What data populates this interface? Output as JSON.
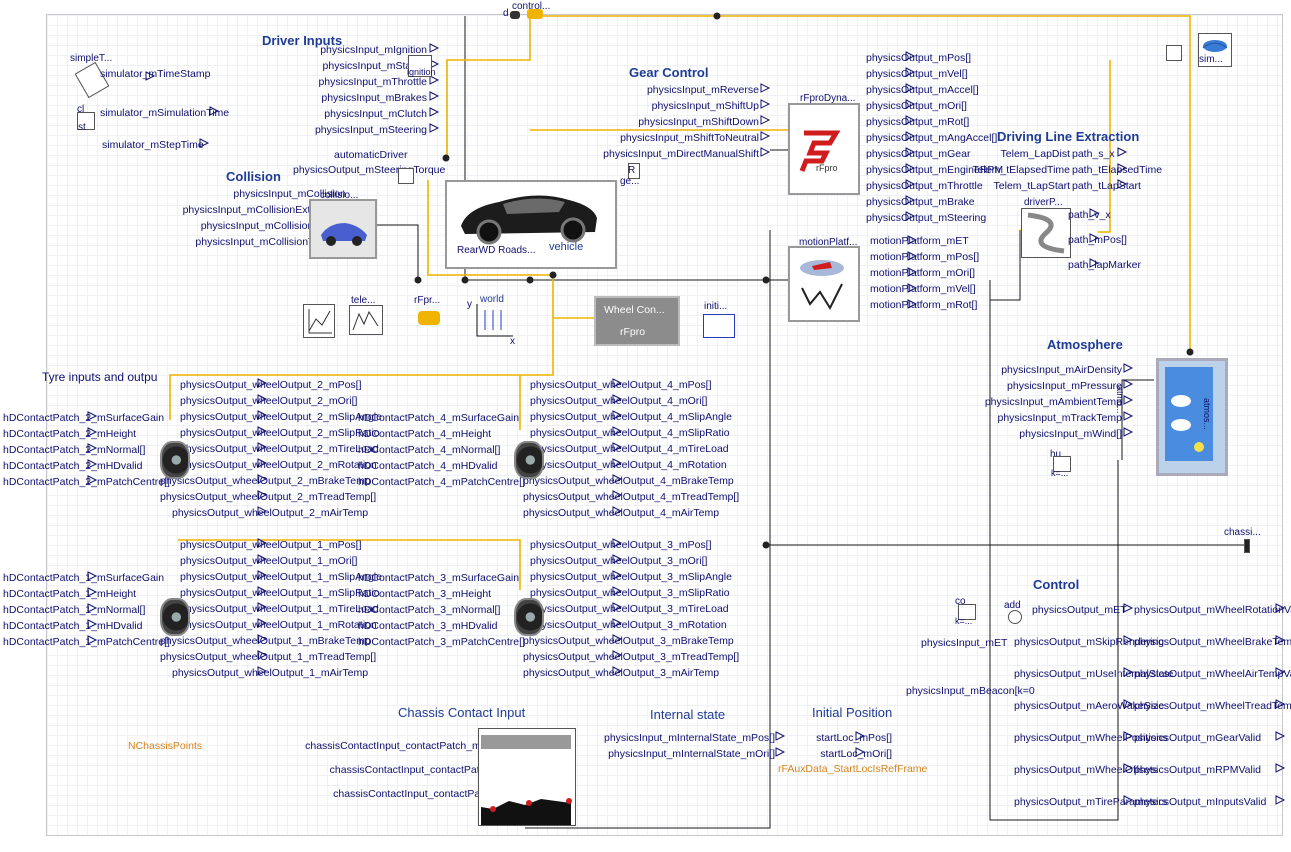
{
  "sections": {
    "driver_inputs": "Driver Inputs",
    "gear_control": "Gear Control",
    "collision": "Collision",
    "driving_line": "Driving Line Extraction",
    "atmosphere": "Atmosphere",
    "tyre_io": "Tyre inputs and outpu",
    "control": "Control",
    "chassis_contact": "Chassis Contact Input",
    "internal_state": "Internal state",
    "initial_position": "Initial Position"
  },
  "driver_inputs": [
    "physicsInput_mIgnition",
    "physicsInput_mStarter",
    "physicsInput_mThrottle",
    "physicsInput_mBrakes",
    "physicsInput_mClutch",
    "physicsInput_mSteering"
  ],
  "driver_extra": {
    "automatic": "automaticDriver",
    "steer_torque": "physicsOutput_mSteeringTorque",
    "ignition": "ignition"
  },
  "gear_inputs": [
    "physicsInput_mReverse",
    "physicsInput_mShiftUp",
    "physicsInput_mShiftDown",
    "physicsInput_mShiftToNeutral",
    "physicsInput_mDirectManualShift"
  ],
  "gear_extra": {
    "r": "R",
    "ge": "ge..."
  },
  "collision_inputs": [
    "physicsInput_mCollision",
    "physicsInput_mCollisionExtVector[]",
    "physicsInput_mCollisionForce[]",
    "physicsInput_mCollisionTorque[]"
  ],
  "collision_block": "collisio...",
  "top_left": {
    "simple": "simpleT...",
    "timestamp": "simulator_mTimeStamp",
    "cl": "cl",
    "simtime": "simulator_mSimulationTime",
    "st": "st",
    "steptime": "simulator_mStepTime"
  },
  "control_top": {
    "d": "d",
    "controller": "control..."
  },
  "sim_block": "sim...",
  "dyna": {
    "title": "rFproDyna...",
    "outputs": [
      "physicsOutput_mPos[]",
      "physicsOutput_mVel[]",
      "physicsOutput_mAccel[]",
      "physicsOutput_mOri[]",
      "physicsOutput_mRot[]",
      "physicsOutput_mAngAccel[]",
      "physicsOutput_mGear",
      "physicsOutput_mEngineRPM",
      "physicsOutput_mThrottle",
      "physicsOutput_mBrake",
      "physicsOutput_mSteering"
    ]
  },
  "logo_text": "rFpro",
  "motion": {
    "title": "motionPlatf...",
    "outputs": [
      "motionPlatform_mET",
      "motionPlatform_mPos[]",
      "motionPlatform_mOri[]",
      "motionPlatform_mVel[]",
      "motionPlatform_mRot[]"
    ]
  },
  "driving_line": {
    "telem": [
      "Telem_LapDist",
      "Telem_tElapsedTime",
      "Telem_tLapStart"
    ],
    "path_top": [
      "path_s_x",
      "path_tElapsedTime",
      "path_tLapStart"
    ],
    "driver_p": "driverP...",
    "path_bottom": [
      "path_v_x",
      "path_mPos[]",
      "path_lapMarker"
    ]
  },
  "vehicle": {
    "name": "RearWD Roads...",
    "label": "vehicle"
  },
  "small_blocks": {
    "tele": "tele...",
    "rfpr": "rFpr...",
    "world": "world",
    "y": "y",
    "x": "x",
    "wheel_con": "Wheel Con...",
    "wheel_con_sub": "rFpro",
    "initi": "initi..."
  },
  "atmosphere": {
    "inputs": [
      "physicsInput_mAirDensity",
      "physicsInput_mPressure",
      "physicsInput_mAmbientTemp",
      "physicsInput_mTrackTemp",
      "physicsInput_mWind[]"
    ],
    "atmo": "atmo...",
    "atmos": "atmos...",
    "hu": "hu",
    "k": "k=..."
  },
  "chassis_out": "chassi...",
  "wheels": {
    "w2_in": [
      "hDContactPatch_2_mSurfaceGain",
      "hDContactPatch_2_mHeight",
      "hDContactPatch_2_mNormal[]",
      "hDContactPatch_2_mHDvalid",
      "hDContactPatch_2_mPatchCentre[]"
    ],
    "w2_out": [
      "physicsOutput_wheelOutput_2_mPos[]",
      "physicsOutput_wheelOutput_2_mOri[]",
      "physicsOutput_wheelOutput_2_mSlipAngle",
      "physicsOutput_wheelOutput_2_mSlipRatio",
      "physicsOutput_wheelOutput_2_mTireLoad",
      "physicsOutput_wheelOutput_2_mRotation",
      "physicsOutput_wheelOutput_2_mBrakeTemp",
      "physicsOutput_wheelOutput_2_mTreadTemp[]",
      "physicsOutput_wheelOutput_2_mAirTemp"
    ],
    "w4_in": [
      "hDContactPatch_4_mSurfaceGain",
      "hDContactPatch_4_mHeight",
      "hDContactPatch_4_mNormal[]",
      "hDContactPatch_4_mHDvalid",
      "hDContactPatch_4_mPatchCentre[]"
    ],
    "w4_out": [
      "physicsOutput_wheelOutput_4_mPos[]",
      "physicsOutput_wheelOutput_4_mOri[]",
      "physicsOutput_wheelOutput_4_mSlipAngle",
      "physicsOutput_wheelOutput_4_mSlipRatio",
      "physicsOutput_wheelOutput_4_mTireLoad",
      "physicsOutput_wheelOutput_4_mRotation",
      "physicsOutput_wheelOutput_4_mBrakeTemp",
      "physicsOutput_wheelOutput_4_mTreadTemp[]",
      "physicsOutput_wheelOutput_4_mAirTemp"
    ],
    "w1_in": [
      "hDContactPatch_1_mSurfaceGain",
      "hDContactPatch_1_mHeight",
      "hDContactPatch_1_mNormal[]",
      "hDContactPatch_1_mHDvalid",
      "hDContactPatch_1_mPatchCentre[]"
    ],
    "w1_out": [
      "physicsOutput_wheelOutput_1_mPos[]",
      "physicsOutput_wheelOutput_1_mOri[]",
      "physicsOutput_wheelOutput_1_mSlipAngle",
      "physicsOutput_wheelOutput_1_mSlipRatio",
      "physicsOutput_wheelOutput_1_mTireLoad",
      "physicsOutput_wheelOutput_1_mRotation",
      "physicsOutput_wheelOutput_1_mBrakeTemp",
      "physicsOutput_wheelOutput_1_mTreadTemp[]",
      "physicsOutput_wheelOutput_1_mAirTemp"
    ],
    "w3_in": [
      "hDContactPatch_3_mSurfaceGain",
      "hDContactPatch_3_mHeight",
      "hDContactPatch_3_mNormal[]",
      "hDContactPatch_3_mHDvalid",
      "hDContactPatch_3_mPatchCentre[]"
    ],
    "w3_out": [
      "physicsOutput_wheelOutput_3_mPos[]",
      "physicsOutput_wheelOutput_3_mOri[]",
      "physicsOutput_wheelOutput_3_mSlipAngle",
      "physicsOutput_wheelOutput_3_mSlipRatio",
      "physicsOutput_wheelOutput_3_mTireLoad",
      "physicsOutput_wheelOutput_3_mRotation",
      "physicsOutput_wheelOutput_3_mBrakeTemp",
      "physicsOutput_wheelOutput_3_mTreadTemp[]",
      "physicsOutput_wheelOutput_3_mAirTemp"
    ]
  },
  "control": {
    "co": "co",
    "add": "add",
    "k1": "k=...",
    "inputs": [
      "physicsInput_mET",
      "physicsInput_mBeacon[k=0"
    ],
    "col1": [
      "physicsOutput_mET",
      "physicsOutput_mSkipRendering",
      "physicsOutput_mUseInternalState",
      "physicsOutput_mAeroWakeSize",
      "physicsOutput_mWheelPositions",
      "physicsOutput_mWheelOffsets",
      "physicsOutput_mTireParameters"
    ],
    "col2": [
      "physicsOutput_mWheelRotationValid",
      "physicsOutput_mWheelBrakeTempValid",
      "physicsOutput_mWheelAirTempValid",
      "physicsOutput_mWheelTreadTempValid",
      "physicsOutput_mGearValid",
      "physicsOutput_mRPMValid",
      "physicsOutput_mInputsValid"
    ]
  },
  "chassis_contact": {
    "nchassis": "NChassisPoints",
    "inputs": [
      "chassisContactInput_contactPatch_mSurfaceGain[]",
      "chassisContactInput_contactPatch_mNormal[]",
      "chassisContactInput_contactPatch_mHeight[]"
    ]
  },
  "internal_state": [
    "physicsInput_mInternalState_mPos[]",
    "physicsInput_mInternalState_mOri[]"
  ],
  "initial_position": {
    "items": [
      "startLoc_mPos[]",
      "startLoc_mOri[]"
    ],
    "ref": "rFAuxData_StartLocIsRefFrame"
  },
  "colors": {
    "signal": "#101070",
    "title": "#1e3c96",
    "bus": "#f0b400",
    "wire": "#1a1a1a",
    "accent": "#d7841e"
  }
}
